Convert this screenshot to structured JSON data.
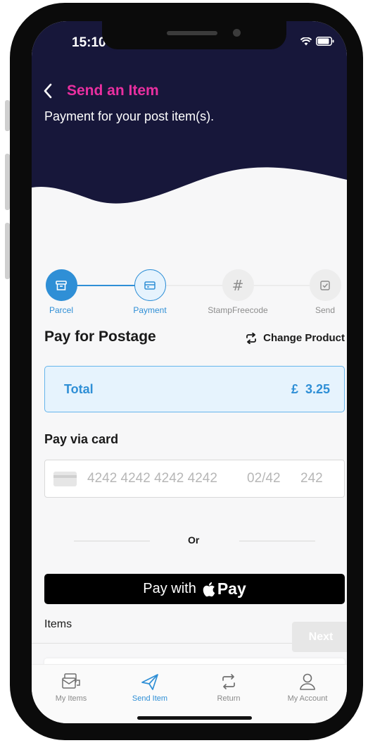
{
  "status_bar": {
    "time": "15:10"
  },
  "header": {
    "title": "Send an Item",
    "subtitle": "Payment for your post item(s)."
  },
  "stepper": {
    "steps": [
      {
        "label": "Parcel",
        "state": "done"
      },
      {
        "label": "Payment",
        "state": "current"
      },
      {
        "label": "StampFreecode",
        "state": "pending"
      },
      {
        "label": "Send",
        "state": "pending"
      }
    ]
  },
  "payment": {
    "section_title": "Pay for Postage",
    "change_product_label": "Change Product",
    "total_label": "Total",
    "total_value": "£  3.25",
    "card_section_title": "Pay via card",
    "card_number_placeholder": "4242 4242 4242 4242",
    "card_expiry_placeholder": "02/42",
    "card_cvc_placeholder": "242",
    "or_label": "Or",
    "apple_pay_prefix": "Pay with",
    "apple_pay_brand": "Pay"
  },
  "items": {
    "label": "Items",
    "next_label": "Next"
  },
  "tabbar": {
    "tabs": [
      {
        "label": "My Items",
        "icon": "my-items-icon",
        "active": false
      },
      {
        "label": "Send Item",
        "icon": "send-icon",
        "active": true
      },
      {
        "label": "Return",
        "icon": "return-icon",
        "active": false
      },
      {
        "label": "My Account",
        "icon": "account-icon",
        "active": false
      }
    ]
  },
  "colors": {
    "header_bg": "#17173a",
    "title_accent": "#e92fa0",
    "primary_blue": "#2f8fd6",
    "total_bg": "#e6f3fd",
    "total_border": "#66b5ec"
  }
}
